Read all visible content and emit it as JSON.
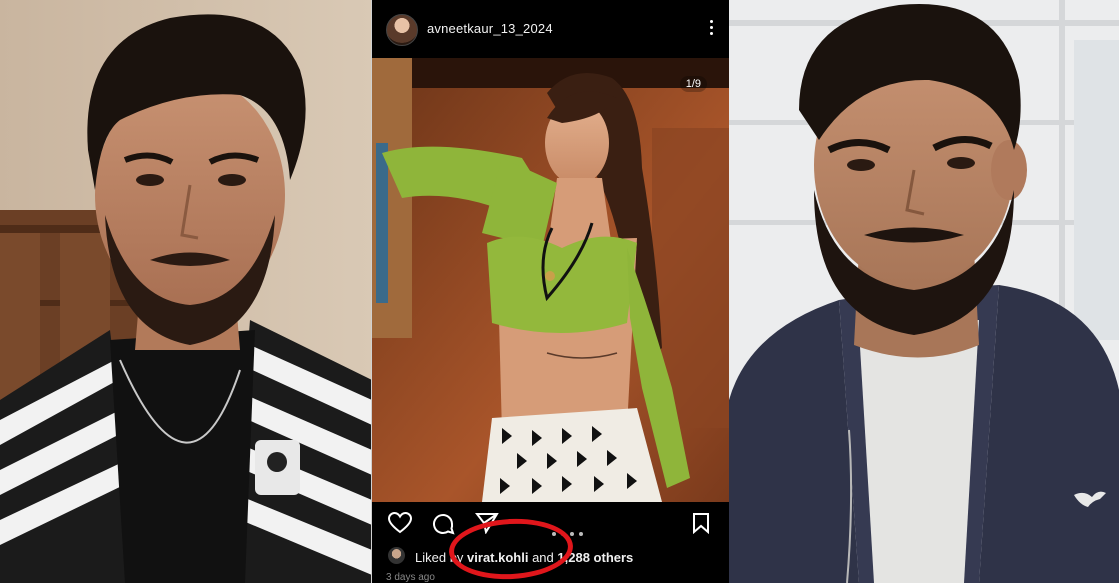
{
  "post": {
    "username": "avneetkaur_13_2024",
    "slide_counter": "1/9",
    "likes_prefix": "Liked by ",
    "liked_by_user": "virat.kohli",
    "likes_middle": " and ",
    "likes_count": "1,288",
    "likes_suffix": " others",
    "time_ago": "3 days ago"
  },
  "icons": {
    "more": "more-vertical-icon",
    "like": "heart-icon",
    "comment": "comment-icon",
    "share": "send-icon",
    "save": "bookmark-icon",
    "carousel": "carousel-dots"
  },
  "colors": {
    "annotation": "#e0161b",
    "ig_background": "#000000",
    "ig_text": "#f2f2f2"
  }
}
